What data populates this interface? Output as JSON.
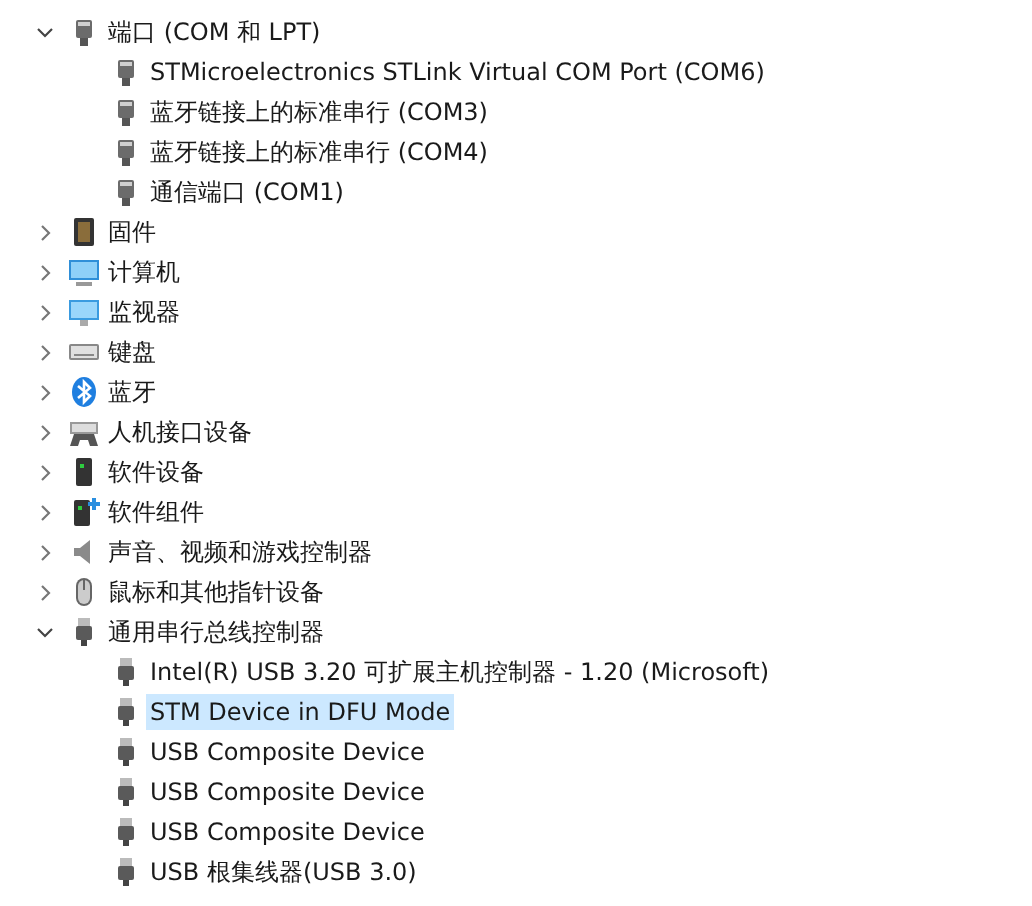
{
  "tree": [
    {
      "label": "端口 (COM 和 LPT)",
      "kind": "port",
      "expanded": true,
      "selected": false,
      "children": [
        {
          "label": "STMicroelectronics STLink Virtual COM Port (COM6)",
          "kind": "port",
          "selected": false
        },
        {
          "label": "蓝牙链接上的标准串行 (COM3)",
          "kind": "port",
          "selected": false
        },
        {
          "label": "蓝牙链接上的标准串行 (COM4)",
          "kind": "port",
          "selected": false
        },
        {
          "label": "通信端口 (COM1)",
          "kind": "port",
          "selected": false
        }
      ]
    },
    {
      "label": "固件",
      "kind": "chip",
      "expanded": false,
      "selected": false
    },
    {
      "label": "计算机",
      "kind": "computer",
      "expanded": false,
      "selected": false
    },
    {
      "label": "监视器",
      "kind": "monitor",
      "expanded": false,
      "selected": false
    },
    {
      "label": "键盘",
      "kind": "keyboard",
      "expanded": false,
      "selected": false
    },
    {
      "label": "蓝牙",
      "kind": "bluetooth",
      "expanded": false,
      "selected": false
    },
    {
      "label": "人机接口设备",
      "kind": "hid",
      "expanded": false,
      "selected": false
    },
    {
      "label": "软件设备",
      "kind": "software-device",
      "expanded": false,
      "selected": false
    },
    {
      "label": "软件组件",
      "kind": "software-component",
      "expanded": false,
      "selected": false
    },
    {
      "label": "声音、视频和游戏控制器",
      "kind": "speaker",
      "expanded": false,
      "selected": false
    },
    {
      "label": "鼠标和其他指针设备",
      "kind": "mouse",
      "expanded": false,
      "selected": false
    },
    {
      "label": "通用串行总线控制器",
      "kind": "usb",
      "expanded": true,
      "selected": false,
      "children": [
        {
          "label": "Intel(R) USB 3.20 可扩展主机控制器 - 1.20 (Microsoft)",
          "kind": "usb",
          "selected": false
        },
        {
          "label": "STM Device in DFU Mode",
          "kind": "usb",
          "selected": true
        },
        {
          "label": "USB Composite Device",
          "kind": "usb",
          "selected": false
        },
        {
          "label": "USB Composite Device",
          "kind": "usb",
          "selected": false
        },
        {
          "label": "USB Composite Device",
          "kind": "usb",
          "selected": false
        },
        {
          "label": "USB 根集线器(USB 3.0)",
          "kind": "usb",
          "selected": false
        }
      ]
    }
  ]
}
